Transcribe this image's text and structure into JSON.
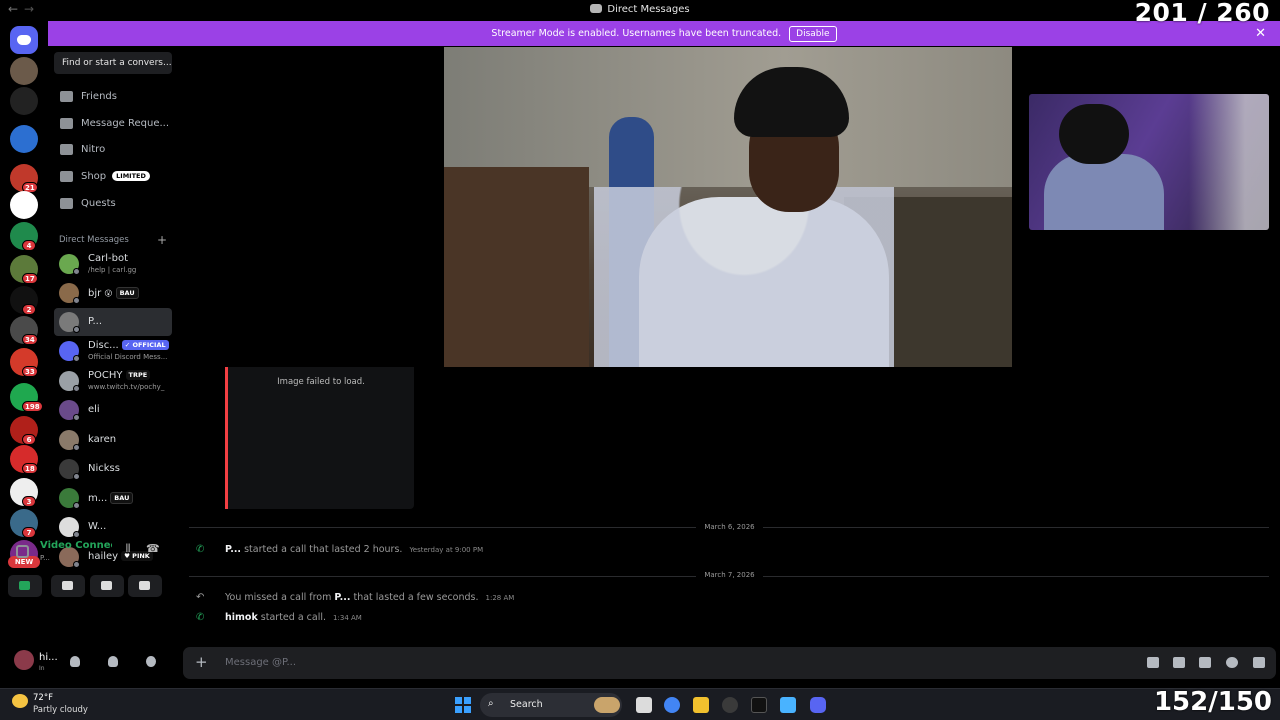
{
  "titlebar": {
    "title": "Direct Messages"
  },
  "overlay": {
    "top_counter": "201 / 260",
    "bottom_counter": "152/150"
  },
  "banner": {
    "text": "Streamer Mode is enabled. Usernames have been truncated.",
    "button": "Disable"
  },
  "rail": {
    "servers": [
      {
        "icon": "discord-home-icon"
      },
      {
        "icon": "server-avatar",
        "color": "#6b5a4a"
      },
      {
        "icon": "server-avatar",
        "color": "#222222"
      },
      {
        "icon": "server-avatar",
        "color": "#2c6fd1"
      },
      {
        "icon": "server-avatar",
        "color": "#c0392b",
        "badge": "21"
      },
      {
        "icon": "server-avatar",
        "color": "#ffffff"
      },
      {
        "icon": "server-avatar",
        "color": "#1f8a4c",
        "badge": "4"
      },
      {
        "icon": "server-avatar",
        "color": "#5c7a3a",
        "badge": "17"
      },
      {
        "icon": "server-avatar",
        "color": "#111111",
        "badge": "2"
      },
      {
        "icon": "server-avatar",
        "color": "#4a4a4a",
        "badge": "34"
      },
      {
        "icon": "server-avatar",
        "color": "#d43a2a",
        "badge": "33"
      },
      {
        "icon": "server-avatar",
        "color": "#1fa84f",
        "badge": "198"
      },
      {
        "icon": "server-avatar",
        "color": "#b0201a",
        "badge": "6"
      },
      {
        "icon": "server-avatar",
        "color": "#d62b2b",
        "badge": "18"
      },
      {
        "icon": "server-avatar",
        "color": "#eeeeee",
        "badge": "3"
      },
      {
        "icon": "server-avatar",
        "color": "#3a6a8a",
        "badge": "7"
      },
      {
        "icon": "server-avatar",
        "color": "#7a2a8a"
      }
    ],
    "new_badge": "NEW"
  },
  "sidebar": {
    "search_placeholder": "Find or start a convers...",
    "nav": [
      {
        "label": "Friends",
        "icon": "friends-icon"
      },
      {
        "label": "Message Reque...",
        "icon": "mail-icon"
      },
      {
        "label": "Nitro",
        "icon": "nitro-icon"
      },
      {
        "label": "Shop",
        "icon": "shop-icon",
        "tag": "LIMITED"
      },
      {
        "label": "Quests",
        "icon": "quests-icon"
      }
    ],
    "dm_header": "Direct Messages",
    "dms": [
      {
        "name": "Carl-bot",
        "sub": "/help | carl.gg",
        "color": "#6aa84f"
      },
      {
        "name": "bjr",
        "emoji": "😮",
        "tag": "BAU",
        "color": "#8a6a4a"
      },
      {
        "name": "P...",
        "color": "#7a7a7a",
        "selected": true
      },
      {
        "name": "Disc...",
        "tag": "✓ OFFICIAL",
        "sub": "Official Discord Mess...",
        "color": "#5865f2"
      },
      {
        "name": "POCHY",
        "tag": "TRPE",
        "sub": "www.twitch.tv/pochy_",
        "color": "#9aa0a6"
      },
      {
        "name": "eli",
        "color": "#6a4a8a"
      },
      {
        "name": "karen",
        "color": "#8a7a6a"
      },
      {
        "name": "Nickss",
        "color": "#3a3a3a"
      },
      {
        "name": "m...",
        "tag": "BAU",
        "color": "#3a7a3a"
      },
      {
        "name": "W...",
        "color": "#dddddd"
      },
      {
        "name": "hailey",
        "tag": "♥ PINK",
        "color": "#8a6a5a"
      }
    ]
  },
  "voice": {
    "status": "Video Connected",
    "channel": "P..."
  },
  "user": {
    "name": "hi...",
    "status": "In"
  },
  "main": {
    "image_failed": "Image failed to load.",
    "dividers": [
      "March 6, 2026",
      "March 7, 2026"
    ],
    "messages": [
      {
        "user": "P...",
        "text": "started a call that lasted 2 hours.",
        "time": "Yesterday at 9:00 PM"
      },
      {
        "prefix": "You missed a call from",
        "user": "P...",
        "text": "that lasted a few seconds.",
        "time": "1:28 AM"
      },
      {
        "user": "himok",
        "text": "started a call.",
        "time": "1:34 AM"
      }
    ],
    "composer_placeholder": "Message @P..."
  },
  "taskbar": {
    "temp": "72°F",
    "weather": "Partly cloudy",
    "search": "Search"
  }
}
